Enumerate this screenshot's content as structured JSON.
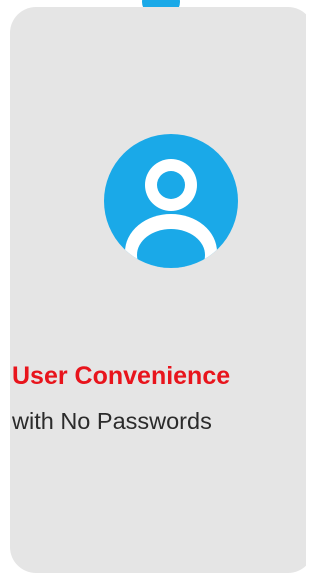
{
  "card": {
    "headline": "User Convenience",
    "subline": "with No Passwords"
  },
  "icons": {
    "avatar": "user-avatar-icon",
    "indicator": "dot-indicator"
  },
  "colors": {
    "accent": "#1aa9e8",
    "headline": "#e8141c",
    "card_background": "#e5e5e5",
    "body_text": "#2b2b2b"
  }
}
